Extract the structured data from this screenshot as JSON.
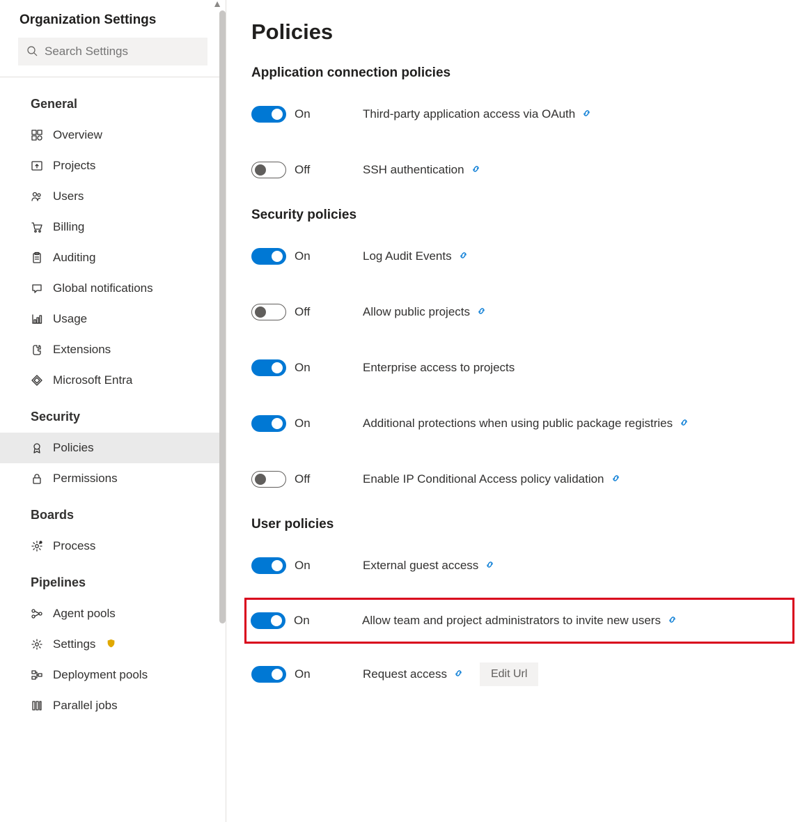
{
  "sidebar": {
    "title": "Organization Settings",
    "search_placeholder": "Search Settings",
    "groups": [
      {
        "title": "General",
        "items": [
          {
            "id": "overview",
            "label": "Overview",
            "icon": "grid"
          },
          {
            "id": "projects",
            "label": "Projects",
            "icon": "upload"
          },
          {
            "id": "users",
            "label": "Users",
            "icon": "people"
          },
          {
            "id": "billing",
            "label": "Billing",
            "icon": "cart"
          },
          {
            "id": "auditing",
            "label": "Auditing",
            "icon": "clipboard"
          },
          {
            "id": "global-notifications",
            "label": "Global notifications",
            "icon": "bubble"
          },
          {
            "id": "usage",
            "label": "Usage",
            "icon": "chart"
          },
          {
            "id": "extensions",
            "label": "Extensions",
            "icon": "puzzle"
          },
          {
            "id": "entra",
            "label": "Microsoft Entra",
            "icon": "diamond"
          }
        ]
      },
      {
        "title": "Security",
        "items": [
          {
            "id": "policies",
            "label": "Policies",
            "icon": "medal",
            "active": true
          },
          {
            "id": "permissions",
            "label": "Permissions",
            "icon": "lock"
          }
        ]
      },
      {
        "title": "Boards",
        "items": [
          {
            "id": "process",
            "label": "Process",
            "icon": "gear-dot"
          }
        ]
      },
      {
        "title": "Pipelines",
        "items": [
          {
            "id": "agent-pools",
            "label": "Agent pools",
            "icon": "nodes"
          },
          {
            "id": "pipe-settings",
            "label": "Settings",
            "icon": "gear",
            "badge": "shield"
          },
          {
            "id": "deployment-pools",
            "label": "Deployment pools",
            "icon": "deploy"
          },
          {
            "id": "parallel-jobs",
            "label": "Parallel jobs",
            "icon": "parallel"
          }
        ]
      }
    ]
  },
  "main": {
    "title": "Policies",
    "on_label": "On",
    "off_label": "Off",
    "edit_url_label": "Edit Url",
    "sections": [
      {
        "title": "Application connection policies",
        "policies": [
          {
            "id": "oauth",
            "on": true,
            "label": "Third-party application access via OAuth",
            "link": true
          },
          {
            "id": "ssh",
            "on": false,
            "label": "SSH authentication",
            "link": true
          }
        ]
      },
      {
        "title": "Security policies",
        "policies": [
          {
            "id": "audit",
            "on": true,
            "label": "Log Audit Events",
            "link": true
          },
          {
            "id": "public-proj",
            "on": false,
            "label": "Allow public projects",
            "link": true
          },
          {
            "id": "enterprise",
            "on": true,
            "label": "Enterprise access to projects",
            "link": false
          },
          {
            "id": "pkg-reg",
            "on": true,
            "label": "Additional protections when using public package registries",
            "link": true
          },
          {
            "id": "ip-ca",
            "on": false,
            "label": "Enable IP Conditional Access policy validation",
            "link": true
          }
        ]
      },
      {
        "title": "User policies",
        "policies": [
          {
            "id": "guest",
            "on": true,
            "label": "External guest access",
            "link": true
          },
          {
            "id": "invite",
            "on": true,
            "label": "Allow team and project administrators to invite new users",
            "link": true,
            "highlight": true
          },
          {
            "id": "request",
            "on": true,
            "label": "Request access",
            "link": true,
            "editUrl": true
          }
        ]
      }
    ]
  }
}
